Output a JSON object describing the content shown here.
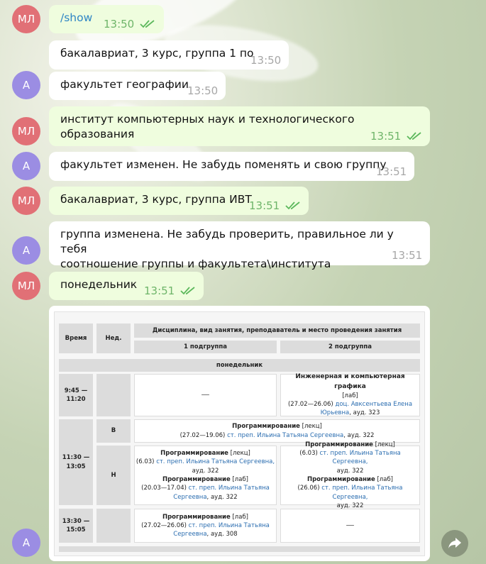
{
  "messages": [
    {
      "sender": "МЛ",
      "text": "/show",
      "time": "13:50"
    },
    {
      "text": "бакалавриат, 3 курс, группа 1 по",
      "time": "13:50"
    },
    {
      "sender": "А",
      "text": "факультет географии",
      "time": "13:50"
    },
    {
      "sender": "МЛ",
      "text": "институт компьютерных наук и технологического образования",
      "time": "13:51"
    },
    {
      "sender": "А",
      "text": "факультет изменен. Не забудь поменять и свою группу",
      "time": "13:51"
    },
    {
      "sender": "МЛ",
      "text": "бакалавриат, 3 курс, группа ИВТ",
      "time": "13:51"
    },
    {
      "sender": "А",
      "line1": "группа изменена. Не забудь проверить, правильное ли у тебя",
      "line2": "соотношение группы и факультета\\института",
      "time": "13:51"
    },
    {
      "sender": "МЛ",
      "text": "понедельник",
      "time": "13:51"
    },
    {
      "sender": "А"
    }
  ],
  "schedule": {
    "col_time": "Время",
    "col_week": "Нед.",
    "col_discipline": "Дисциплина, вид занятия, преподаватель и место проведения занятия",
    "sub1": "1 подгруппа",
    "sub2": "2 подгруппа",
    "day": "понедельник",
    "r1_time": "9:45 — 11:20",
    "r1_left": "—",
    "r1_right_title": "Инженерная и компьютерная графика",
    "r1_right_type": "[лаб]",
    "r1_right_dates": "(27.02—26.06)",
    "r1_right_teacher": "доц. Авксентьева Елена Юрьевна",
    "r1_right_room": ", ауд. 323",
    "r2_time": "11:30 — 13:05",
    "r2_weekB": "В",
    "r2_weekH": "Н",
    "r2b_title": "Программирование",
    "r2b_type": " [лекц]",
    "r2b_dates": "(27.02—19.06) ",
    "r2b_teacher": "ст. преп. Ильина Татьяна Сергеевна",
    "r2b_room": ", ауд. 322",
    "r2h_left_t1": "Программирование",
    "r2h_left_k1": " [лекц]",
    "r2h_left_d1": "(6.03) ",
    "r2h_left_p1": "ст. преп. Ильина Татьяна Сергеевна,",
    "r2h_left_a1": "ауд. 322",
    "r2h_left_t2": "Программирование",
    "r2h_left_k2": " [лаб]",
    "r2h_left_d2": "(20.03—17.04) ",
    "r2h_left_p2a": "ст. преп. Ильина Татьяна",
    "r2h_left_p2b": "Сергеевна",
    "r2h_left_a2": ", ауд. 322",
    "r2h_right_t1": "Программирование",
    "r2h_right_k1": " [лекц]",
    "r2h_right_d1": "(6.03) ",
    "r2h_right_p1": "ст. преп. Ильина Татьяна Сергеевна,",
    "r2h_right_a1": "ауд. 322",
    "r2h_right_t2": "Программирование",
    "r2h_right_k2": " [лаб]",
    "r2h_right_d2": "(26.06) ",
    "r2h_right_p2": "ст. преп. Ильина Татьяна Сергеевна,",
    "r2h_right_a2": "ауд. 322",
    "r3_time": "13:30 — 15:05",
    "r3_left_title": "Программирование",
    "r3_left_type": " [лаб]",
    "r3_left_dates": "(27.02—26.06) ",
    "r3_left_teacher_a": "ст. преп. Ильина Татьяна",
    "r3_left_teacher_b": "Сергеевна",
    "r3_left_room": ", ауд. 308",
    "r3_right": "—"
  },
  "icons": {
    "check": "double-check-icon",
    "forward": "forward-arrow-icon"
  },
  "colors": {
    "outgoing_bubble": "#effdde",
    "incoming_bubble": "#ffffff",
    "avatar_ml": "#e17076",
    "avatar_a": "#9b8de3",
    "read_check": "#5cb85c",
    "link": "#2a6db0"
  }
}
